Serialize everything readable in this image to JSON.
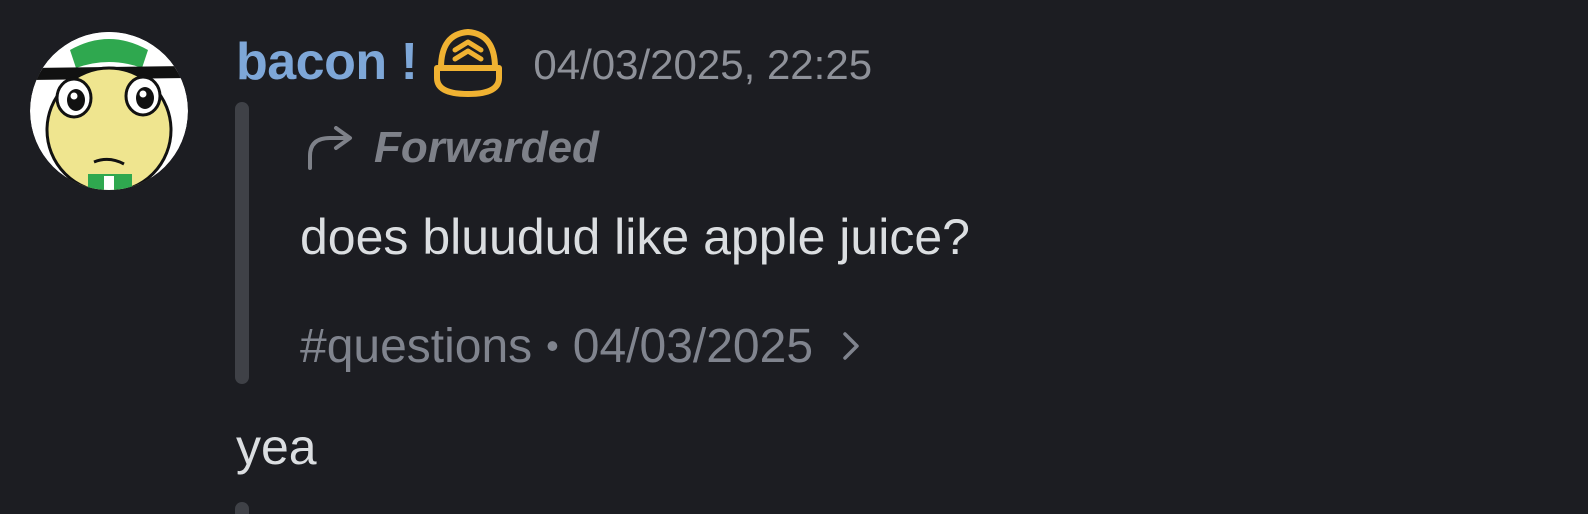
{
  "message": {
    "author": {
      "username": "bacon !",
      "avatar_icon": "avatar-cartoon-face-icon",
      "badge_icon": "helmet-chevron-badge-icon"
    },
    "timestamp": "04/03/2025, 22:25",
    "forwarded": {
      "label": "Forwarded",
      "icon": "forward-arrow-icon",
      "content": "does bluudud like apple juice?",
      "source_channel": "#questions",
      "separator": "•",
      "source_date": "04/03/2025",
      "chevron_icon": "chevron-right-icon"
    },
    "reply_text": "yea"
  },
  "colors": {
    "background": "#1c1d22",
    "username": "#7ea7d8",
    "badge": "#f0b232",
    "muted": "#80848e",
    "text": "#dbdee1",
    "quote_bar": "#3f4147"
  }
}
